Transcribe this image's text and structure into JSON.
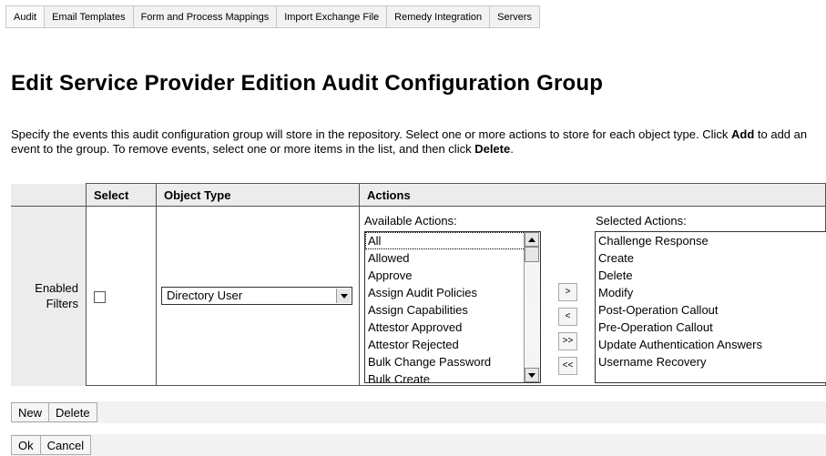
{
  "tabs": [
    "Audit",
    "Email Templates",
    "Form and Process Mappings",
    "Import Exchange File",
    "Remedy Integration",
    "Servers"
  ],
  "page_title": "Edit Service Provider Edition Audit Configuration Group",
  "intro": {
    "p1": "Specify the events this audit configuration group will store in the repository. Select one or more actions to store for each object type. Click ",
    "add": "Add",
    "p2": " to add an event to the group. To remove events, select one or more items in the list, and then click ",
    "delete": "Delete",
    "p3": "."
  },
  "table": {
    "headers": {
      "select": "Select",
      "object_type": "Object Type",
      "actions": "Actions"
    },
    "row_label_line1": "Enabled",
    "row_label_line2": "Filters",
    "object_type_value": "Directory User",
    "available_label": "Available Actions:",
    "selected_label": "Selected Actions:",
    "available_actions": [
      "All",
      "Allowed",
      "Approve",
      "Assign Audit Policies",
      "Assign Capabilities",
      "Attestor Approved",
      "Attestor Rejected",
      "Bulk Change Password",
      "Bulk Create"
    ],
    "selected_actions": [
      "Challenge Response",
      "Create",
      "Delete",
      "Modify",
      "Post-Operation Callout",
      "Pre-Operation Callout",
      "Update Authentication Answers",
      "Username Recovery"
    ],
    "move_buttons": {
      "add_one": ">",
      "remove_one": "<",
      "add_all": ">>",
      "remove_all": "<<"
    }
  },
  "buttons": {
    "new": "New",
    "delete": "Delete",
    "ok": "Ok",
    "cancel": "Cancel"
  }
}
